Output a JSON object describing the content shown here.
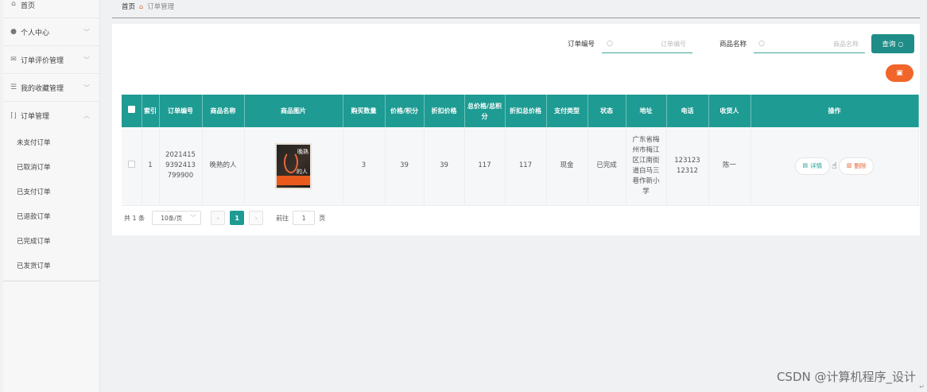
{
  "sidebar": {
    "home": "首页",
    "items": [
      {
        "label": "个人中心"
      },
      {
        "label": "订单评价管理"
      },
      {
        "label": "我的收藏管理"
      },
      {
        "label": "订单管理"
      }
    ],
    "sub_items": [
      "未支付订单",
      "已取消订单",
      "已支付订单",
      "已退款订单",
      "已完成订单",
      "已发货订单"
    ]
  },
  "breadcrumb": {
    "home": "首页",
    "current": "订单管理"
  },
  "search": {
    "order_no_label": "订单编号",
    "order_no_placeholder": "订单编号",
    "product_name_label": "商品名称",
    "product_name_placeholder": "商品名称",
    "query_label": "查询"
  },
  "table": {
    "headers": [
      "索引",
      "订单编号",
      "商品名称",
      "商品图片",
      "购买数量",
      "价格/积分",
      "折扣价格",
      "总价格/总积分",
      "折扣总价格",
      "支付类型",
      "状态",
      "地址",
      "电话",
      "收货人",
      "操作"
    ],
    "rows": [
      {
        "index": "1",
        "order_no": "20214159392413799900",
        "product_name": "晚熟的人",
        "image_title_a": "晚熟",
        "image_title_b": "的人",
        "quantity": "3",
        "price": "39",
        "discount_price": "39",
        "total": "117",
        "discount_total": "117",
        "pay_type": "现金",
        "status": "已完成",
        "address": "广东省梅州市梅江区江南街道白马三巷作新小学",
        "phone": "12312312312",
        "receiver": "陈一",
        "detail_label": "详情",
        "delete_label": "删除"
      }
    ]
  },
  "pagination": {
    "total": "共 1 条",
    "page_size": "10条/页",
    "current_page": "1",
    "goto_prefix": "前往",
    "goto_value": "1",
    "goto_suffix": "页"
  },
  "watermark": "CSDN @计算机程序_设计",
  "colors": {
    "primary": "#1e9b93",
    "danger": "#f1652a",
    "query": "#1f8c87"
  }
}
